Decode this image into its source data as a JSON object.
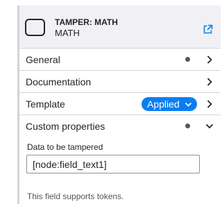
{
  "header": {
    "title": "TAMPER: MATH",
    "subtitle": "MATH",
    "plugin_icon": "rounded-square-icon",
    "link_icon": "external-link-icon"
  },
  "sections": [
    {
      "label": "General",
      "has_dot": true,
      "expanded": false
    },
    {
      "label": "Documentation",
      "has_dot": false,
      "expanded": false
    },
    {
      "label": "Template",
      "badge": "Applied",
      "expanded": false
    },
    {
      "label": "Custom properties",
      "has_dot": true,
      "expanded": true
    }
  ],
  "custom_properties": {
    "field_label": "Data to be tampered",
    "field_value": "[node:field_text1]",
    "help_text": "This field supports tokens."
  },
  "colors": {
    "accent": "#0a7ef0",
    "header_bg": "#f0f0f5",
    "border": "#d3d4d9",
    "text": "#232429",
    "dot": "#545560"
  }
}
